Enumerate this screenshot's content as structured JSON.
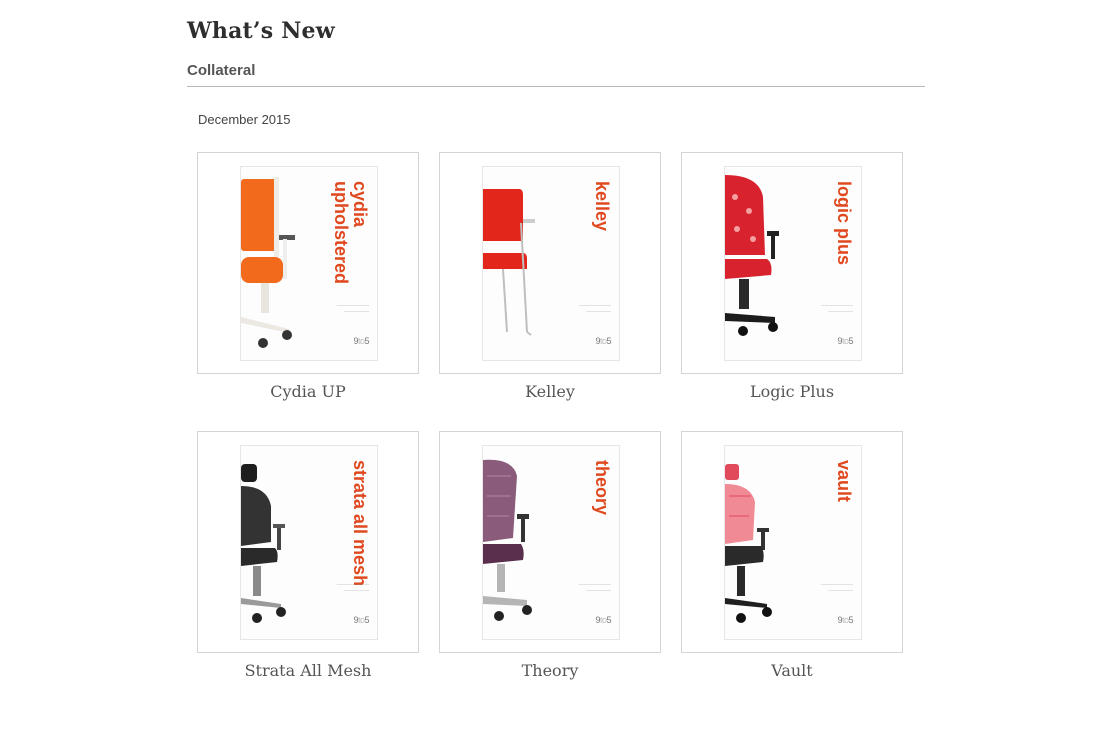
{
  "header": {
    "title": "What’s New",
    "section": "Collateral"
  },
  "group": {
    "date": "December 2015"
  },
  "colors": {
    "accent": "#e0491f",
    "rule": "#b8b8b8",
    "border": "#d4d4d4"
  },
  "items": [
    {
      "label": "Cydia UP",
      "cover_title": "cydia upholstered",
      "chair_color": "#f26a1b",
      "frame_color": "#f0ede6"
    },
    {
      "label": "Kelley",
      "cover_title": "kelley",
      "chair_color": "#e3261b",
      "frame_color": "#bfbfbf"
    },
    {
      "label": "Logic Plus",
      "cover_title": "logic plus",
      "chair_color": "#d8232f",
      "frame_color": "#1c1c1c"
    },
    {
      "label": "Strata All Mesh",
      "cover_title": "strata all mesh",
      "chair_color": "#2a2a2a",
      "frame_color": "#9a9a9a"
    },
    {
      "label": "Theory",
      "cover_title": "theory",
      "chair_color": "#6b3b5a",
      "frame_color": "#b5b5b5"
    },
    {
      "label": "Vault",
      "cover_title": "vault",
      "chair_color": "#e14a5a",
      "frame_color": "#1f1f1f"
    }
  ]
}
